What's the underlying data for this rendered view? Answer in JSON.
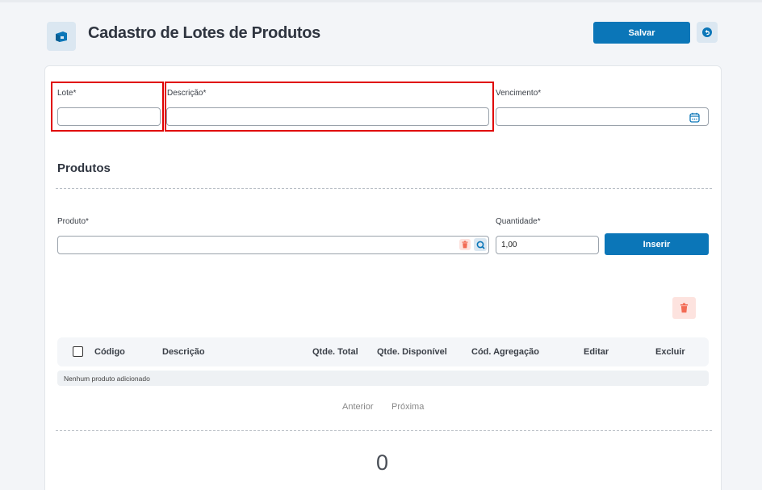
{
  "header": {
    "title": "Cadastro de Lotes de Produtos",
    "save_label": "Salvar",
    "page_icon": "box-icon",
    "back_icon": "undo-icon"
  },
  "form": {
    "lote_label": "Lote*",
    "lote_value": "",
    "descricao_label": "Descrição*",
    "descricao_value": "",
    "vencimento_label": "Vencimento*",
    "vencimento_value": "",
    "calendar_icon": "calendar-icon"
  },
  "produtos": {
    "section_title": "Produtos",
    "produto_label": "Produto*",
    "produto_value": "",
    "quantidade_label": "Quantidade*",
    "quantidade_value": "1,00",
    "insert_label": "Inserir"
  },
  "table": {
    "columns": [
      "Código",
      "Descrição",
      "Qtde. Total",
      "Qtde. Disponível",
      "Cód. Agregação",
      "Editar",
      "Excluir"
    ],
    "empty_message": "Nenhum produto adicionado"
  },
  "pagination": {
    "prev_label": "Anterior",
    "next_label": "Próxima"
  },
  "summary": {
    "total": "0"
  },
  "colors": {
    "primary": "#0b76b8",
    "danger": "#f26b55",
    "highlight": "#e00000"
  }
}
